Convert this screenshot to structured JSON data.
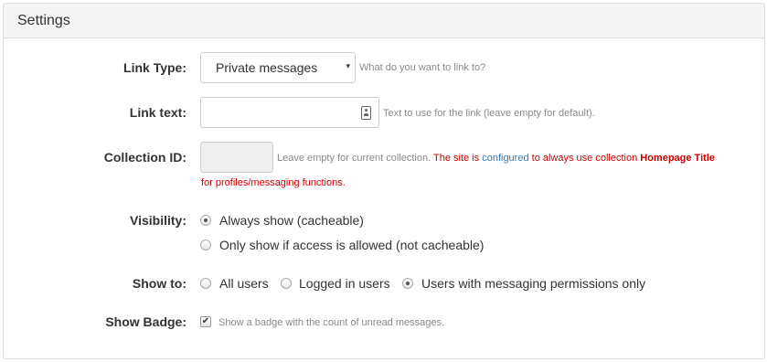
{
  "panel": {
    "title": "Settings"
  },
  "link_type": {
    "label": "Link Type:",
    "selected": "Private messages",
    "caret": "▾",
    "help": "What do you want to link to?"
  },
  "link_text": {
    "label": "Link text:",
    "value": "",
    "icon": "contact-card-icon",
    "help": "Text to use for the link (leave empty for default)."
  },
  "collection_id": {
    "label": "Collection ID:",
    "value": "",
    "help": "Leave empty for current collection.",
    "warning_part1": "The site is",
    "warning_link": "configured",
    "warning_part2": "to always use collection",
    "warning_collection": "Homepage Title",
    "warning_part3": "for profiles/messaging functions."
  },
  "visibility": {
    "label": "Visibility:",
    "options": [
      {
        "label": "Always show (cacheable)",
        "checked": true
      },
      {
        "label": "Only show if access is allowed (not cacheable)",
        "checked": false
      }
    ]
  },
  "show_to": {
    "label": "Show to:",
    "options": [
      {
        "label": "All users",
        "checked": false
      },
      {
        "label": "Logged in users",
        "checked": false
      },
      {
        "label": "Users with messaging permissions only",
        "checked": true
      }
    ]
  },
  "show_badge": {
    "label": "Show Badge:",
    "checked": true,
    "check_glyph": "✔",
    "help": "Show a badge with the count of unread messages."
  },
  "colors": {
    "panel_heading_bg": "#f5f5f5",
    "border": "#dddddd",
    "warning_red": "#cc0000",
    "link_blue": "#337ab7",
    "help_gray": "#8a8a8a"
  }
}
